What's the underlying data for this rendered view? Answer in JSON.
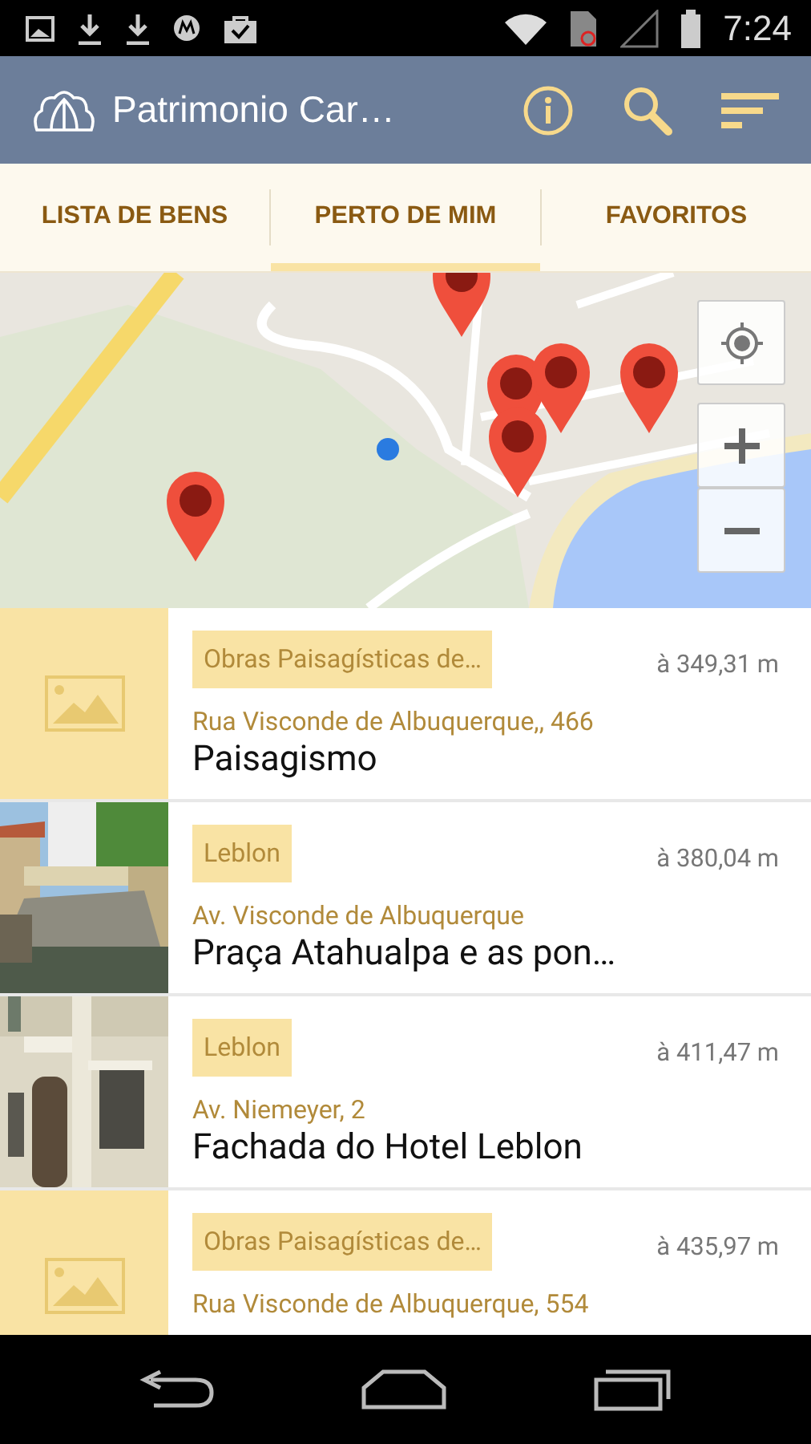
{
  "status_bar": {
    "time": "7:24"
  },
  "app_bar": {
    "title": "Patrimonio Car…"
  },
  "tabs": [
    {
      "label": "LISTA DE BENS",
      "selected": false
    },
    {
      "label": "PERTO DE MIM",
      "selected": true
    },
    {
      "label": "FAVORITOS",
      "selected": false
    }
  ],
  "places": [
    {
      "kind": "placeholder",
      "tag": "Obras Paisagísticas de…",
      "distance": "à 349,31 m",
      "address": "Rua Visconde de Albuquerque,, 466",
      "name": "Paisagismo"
    },
    {
      "kind": "canal",
      "tag": "Leblon",
      "distance": "à 380,04 m",
      "address": "Av. Visconde de Albuquerque",
      "name": "Praça Atahualpa e as pon…"
    },
    {
      "kind": "building",
      "tag": "Leblon",
      "distance": "à 411,47 m",
      "address": "Av. Niemeyer, 2",
      "name": "Fachada do Hotel Leblon"
    },
    {
      "kind": "placeholder",
      "tag": "Obras Paisagísticas de…",
      "distance": "à 435,97 m",
      "address": "Rua Visconde de Albuquerque, 554"
    }
  ]
}
